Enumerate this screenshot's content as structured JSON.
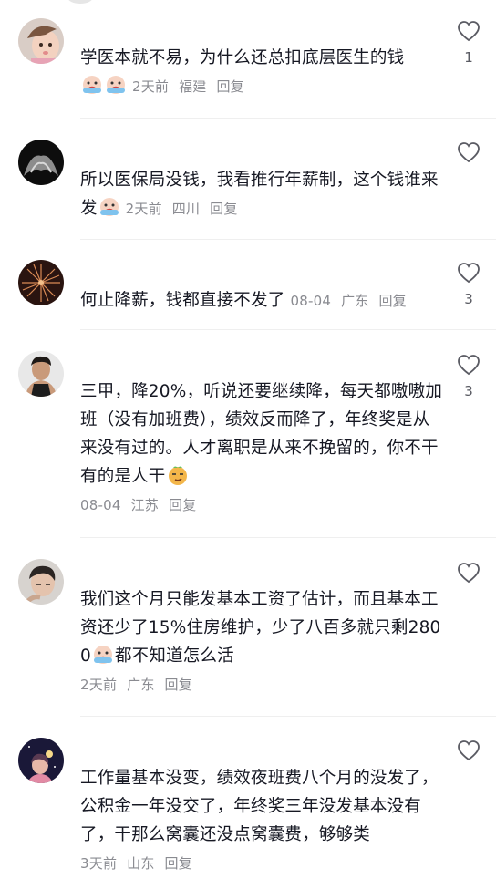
{
  "comments": [
    {
      "text": "学医本就不易，为什么还总扣底层医生的钱",
      "time": "2天前",
      "location": "福建",
      "reply": "回复",
      "likes": "1",
      "avatar_icon": "child-avatar",
      "emoji": [
        "crying-emoji",
        "crying-emoji"
      ]
    },
    {
      "text": "所以医保局没钱，我看推行年薪制，这个钱谁来发",
      "time": "2天前",
      "location": "四川",
      "reply": "回复",
      "likes": "",
      "avatar_icon": "dark-silhouette-avatar",
      "emoji": [
        "crying-emoji"
      ]
    },
    {
      "text": "何止降薪，钱都直接不发了",
      "time": "08-04",
      "location": "广东",
      "reply": "回复",
      "likes": "3",
      "avatar_icon": "firework-avatar"
    },
    {
      "text": "三甲，降20%，听说还要继续降，每天都嗷嗷加班（没有加班费），绩效反而降了，年终奖是从来没有过的。人才离职是从来不挽留的，你不干有的是人干",
      "time": "08-04",
      "location": "江苏",
      "reply": "回复",
      "likes": "3",
      "avatar_icon": "man-avatar",
      "emoji": [
        "smirk-emoji"
      ]
    },
    {
      "text_before": "我们这个月只能发基本工资了估计，而且基本工资还少了15%住房维护，少了八百多就只剩2800",
      "text_after": "都不知道怎么活",
      "time": "2天前",
      "location": "广东",
      "reply": "回复",
      "likes": "",
      "avatar_icon": "portrait-avatar",
      "emoji": [
        "crying-emoji"
      ]
    },
    {
      "text": "工作量基本没变，绩效夜班费八个月的没发了，公积金一年没交了，年终奖三年没发基本没有了，干那么窝囊还没点窝囊费，够够类",
      "time": "3天前",
      "location": "山东",
      "reply": "回复",
      "likes": "",
      "avatar_icon": "night-avatar"
    }
  ],
  "colors": {
    "text": "#161823",
    "meta": "#8a8b91",
    "divider": "#efefef"
  }
}
